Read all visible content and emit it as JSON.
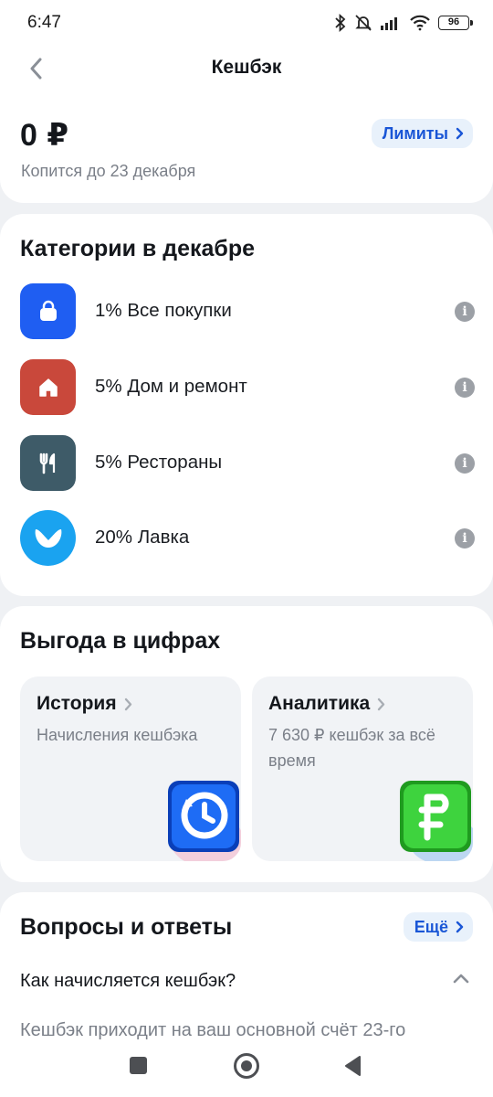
{
  "status_bar": {
    "time": "6:47",
    "battery": "96"
  },
  "header": {
    "title": "Кешбэк"
  },
  "summary": {
    "balance": "0 ₽",
    "accumulate_text": "Копится до 23 декабря",
    "limits_label": "Лимиты"
  },
  "categories": {
    "title": "Категории в декабре",
    "items": [
      {
        "label": "1% Все покупки",
        "icon": "shopping-bag-icon",
        "color": "#1f5ef2"
      },
      {
        "label": "5% Дом и ремонт",
        "icon": "house-icon",
        "color": "#c9483b"
      },
      {
        "label": "5% Рестораны",
        "icon": "cutlery-icon",
        "color": "#3e5b68"
      },
      {
        "label": "20% Лавка",
        "icon": "lavka-logo-icon",
        "color": "#1aa3f0"
      }
    ]
  },
  "benefits": {
    "title": "Выгода в цифрах",
    "history": {
      "title": "История",
      "subtitle": "Начисления кешбэка"
    },
    "analytics": {
      "title": "Аналитика",
      "subtitle": "7 630 ₽ кешбэк за всё время"
    }
  },
  "faq": {
    "title": "Вопросы и ответы",
    "more_label": "Ещё",
    "question": "Как начисляется кешбэк?",
    "answer": "Кешбэк приходит на ваш основной счёт 23-го"
  },
  "colors": {
    "accent": "#1a56d6",
    "pill_bg": "#e8f1fb",
    "background": "#eff1f4"
  }
}
